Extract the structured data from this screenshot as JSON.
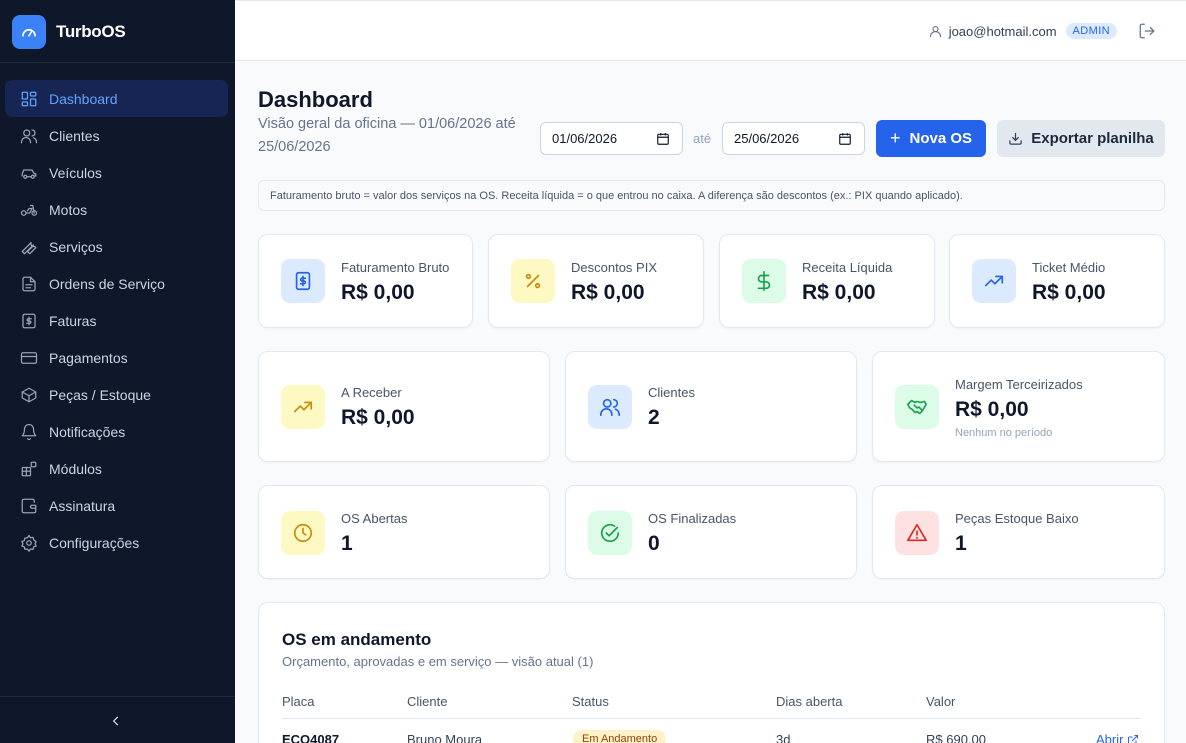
{
  "brand": {
    "name": "TurboOS"
  },
  "sidebar": {
    "items": [
      {
        "label": "Dashboard",
        "icon": "dashboard-icon",
        "active": true
      },
      {
        "label": "Clientes",
        "icon": "users-icon"
      },
      {
        "label": "Veículos",
        "icon": "car-icon"
      },
      {
        "label": "Motos",
        "icon": "motorcycle-icon"
      },
      {
        "label": "Serviços",
        "icon": "wrench-icon"
      },
      {
        "label": "Ordens de Serviço",
        "icon": "file-text-icon"
      },
      {
        "label": "Faturas",
        "icon": "receipt-icon"
      },
      {
        "label": "Pagamentos",
        "icon": "credit-card-icon"
      },
      {
        "label": "Peças / Estoque",
        "icon": "package-icon"
      },
      {
        "label": "Notificações",
        "icon": "bell-icon"
      },
      {
        "label": "Módulos",
        "icon": "blocks-icon"
      },
      {
        "label": "Assinatura",
        "icon": "wallet-icon"
      },
      {
        "label": "Configurações",
        "icon": "settings-icon"
      }
    ]
  },
  "header": {
    "email": "joao@hotmail.com",
    "role": "ADMIN"
  },
  "page": {
    "title": "Dashboard",
    "subtitle": "Visão geral da oficina — 01/06/2026 até 25/06/2026",
    "date_from": "01/06/2026",
    "date_sep": "até",
    "date_to": "25/06/2026",
    "new_button": "Nova OS",
    "export_button": "Exportar planilha",
    "info": "Faturamento bruto = valor dos serviços na OS. Receita líquida = o que entrou no caixa. A diferença são descontos (ex.: PIX quando aplicado)."
  },
  "stats": {
    "faturamento": {
      "label": "Faturamento Bruto",
      "value": "R$ 0,00"
    },
    "descontos": {
      "label": "Descontos PIX",
      "value": "R$ 0,00"
    },
    "receita": {
      "label": "Receita Líquida",
      "value": "R$ 0,00"
    },
    "ticket": {
      "label": "Ticket Médio",
      "value": "R$ 0,00"
    },
    "receber": {
      "label": "A Receber",
      "value": "R$ 0,00"
    },
    "clientes": {
      "label": "Clientes",
      "value": "2"
    },
    "margem": {
      "label": "Margem Terceirizados",
      "value": "R$ 0,00",
      "note": "Nenhum no período"
    },
    "abertas": {
      "label": "OS Abertas",
      "value": "1"
    },
    "finalizadas": {
      "label": "OS Finalizadas",
      "value": "0"
    },
    "estoque": {
      "label": "Peças Estoque Baixo",
      "value": "1"
    }
  },
  "table": {
    "title": "OS em andamento",
    "subtitle": "Orçamento, aprovadas e em serviço — visão atual (1)",
    "headers": [
      "Placa",
      "Cliente",
      "Status",
      "Dias aberta",
      "Valor"
    ],
    "rows": [
      {
        "placa": "ECO4087",
        "cliente": "Bruno Moura",
        "status": "Em Andamento",
        "dias": "3d",
        "valor": "R$ 690,00",
        "action": "Abrir"
      }
    ]
  },
  "colors": {
    "primary": "#2563eb",
    "sidebar_bg": "#0f172a",
    "active_bg": "#172554"
  }
}
